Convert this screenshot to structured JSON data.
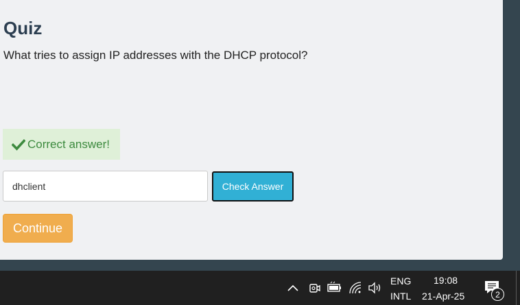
{
  "quiz": {
    "title": "Quiz",
    "question": "What tries to assign IP addresses with the DHCP protocol?",
    "feedback": "Correct answer!",
    "answer_value": "dhclient",
    "check_button_label": "Check Answer",
    "continue_button_label": "Continue"
  },
  "taskbar": {
    "language_line1": "ENG",
    "language_line2": "INTL",
    "time": "19:08",
    "date": "21-Apr-25",
    "notification_count": "2",
    "icons": [
      "chevron-up-icon",
      "meet-now-icon",
      "battery-icon",
      "wifi-icon",
      "volume-icon",
      "notification-icon"
    ]
  },
  "colors": {
    "panel_bg": "#f0f1f3",
    "page_bg": "#34454f",
    "success_bg": "#dff0d8",
    "success_text": "#3c8a3e",
    "info_button": "#31b0d5",
    "warning_button": "#f0ad4e",
    "taskbar_bg": "#202020"
  }
}
